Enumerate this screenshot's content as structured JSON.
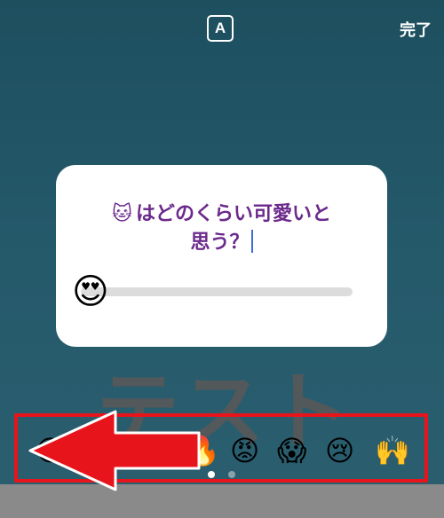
{
  "top_bar": {
    "text_style_label": "A",
    "done_label": "完了"
  },
  "background_text": "テスト",
  "slider_card": {
    "cat_emoji": "🐱",
    "question_line1": "はどのくらい可愛いと",
    "question_line2": "思う？",
    "handle_emoji": "😍",
    "slider_value": 0
  },
  "emoji_picker": {
    "emojis": [
      "😂",
      "🔥",
      "😡",
      "😱",
      "😢",
      "🙌"
    ],
    "page_indicator": {
      "current": 1,
      "total": 2
    }
  },
  "annotation": {
    "arrow_color": "#e8141b",
    "box_color": "#e8141b",
    "arrow_direction": "left"
  }
}
